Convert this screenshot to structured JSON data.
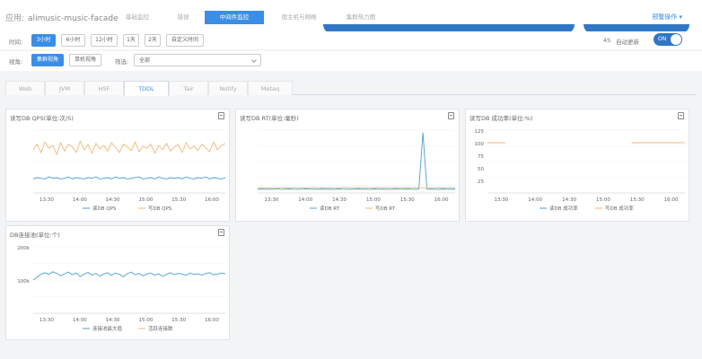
{
  "header": {
    "app_label": "应用:",
    "app_name": "alimusic-music-facade",
    "tabs": [
      {
        "label": "基础监控"
      },
      {
        "label": "错误"
      },
      {
        "label": "中间件监控"
      },
      {
        "label": "宿主机与网络"
      },
      {
        "label": "集群热力图"
      }
    ],
    "action_link": "预警操作 ▾"
  },
  "time_row": {
    "label": "时间:",
    "options": [
      "3小时",
      "6小时",
      "12小时",
      "1天",
      "2天",
      "自定义时间"
    ],
    "auto_label": "自动更新",
    "auto_interval": "4S",
    "toggle_text": "ON"
  },
  "view_row": {
    "label": "视角:",
    "views": [
      "集群视角",
      "单机视角"
    ],
    "filter_label": "筛选:",
    "filter_value": "全部"
  },
  "subtabs": [
    "Web",
    "JVM",
    "HSF",
    "TDDL",
    "Tair",
    "Notify",
    "Metaq"
  ],
  "colors": {
    "accent": "#3a8ee6",
    "series_blue": "#4d9fd6",
    "series_orange": "#f0b97a"
  },
  "panels": [
    {
      "title": "读写DB QPS(单位:次/S)",
      "legend": [
        "读DB QPS",
        "写DB QPS"
      ]
    },
    {
      "title": "读写DB RT(单位:毫秒)",
      "legend": [
        "读DB RT",
        "写DB RT"
      ]
    },
    {
      "title": "读写DB 成功率(单位:%)",
      "legend": [
        "读DB 成功率",
        "写DB 成功率"
      ]
    },
    {
      "title": "DB连接池(单位:个)",
      "legend": [
        "连接池最大值",
        "活跃连接数"
      ]
    }
  ],
  "chart_data": [
    {
      "type": "line",
      "title": "读写DB QPS(单位:次/S)",
      "x": [
        "13:30",
        "14:00",
        "14:30",
        "15:00",
        "15:30",
        "16:00"
      ],
      "series": [
        {
          "name": "写DB QPS",
          "color": "#f0b97a",
          "values": [
            62,
            70,
            58,
            73,
            64,
            68,
            55,
            72,
            60,
            70,
            66,
            58,
            74,
            62,
            69,
            57,
            71,
            63,
            68,
            60,
            72,
            65,
            58,
            70,
            66,
            61,
            73,
            59,
            67,
            64,
            70,
            57,
            68,
            62,
            71,
            60,
            66,
            69,
            58,
            72,
            63,
            67,
            61,
            70,
            65,
            59,
            73,
            62,
            68,
            71
          ]
        },
        {
          "name": "读DB QPS",
          "color": "#4d9fd6",
          "values": [
            20,
            22,
            21,
            20,
            23,
            21,
            22,
            20,
            21,
            23,
            20,
            22,
            21,
            20,
            22,
            21,
            23,
            20,
            21,
            22,
            20,
            23,
            21,
            22,
            20,
            21,
            22,
            23,
            20,
            21,
            22,
            20,
            23,
            21,
            20,
            22,
            21,
            22,
            20,
            23,
            21,
            20,
            22,
            21,
            23,
            20,
            22,
            21,
            20,
            22
          ]
        }
      ]
    },
    {
      "type": "line",
      "title": "读写DB RT(单位:毫秒)",
      "x": [
        "13:30",
        "14:00",
        "14:30",
        "15:00",
        "15:30",
        "16:00"
      ],
      "series": [
        {
          "name": "读DB RT",
          "color": "#4d9fd6",
          "values": [
            3,
            3.2,
            2.9,
            3.1,
            3,
            3.3,
            2.9,
            3.1,
            3.2,
            3,
            2.9,
            3.1,
            3.3,
            3,
            3.1,
            2.9,
            3.2,
            3,
            3.1,
            2.9,
            3.2,
            3.1,
            3,
            2.9,
            3.1,
            3.2,
            3,
            3.1,
            2.9,
            3.2,
            3,
            3.1,
            3,
            2.9,
            3.2,
            3.1,
            3,
            3.2,
            3,
            2.9,
            3.1,
            48,
            3,
            3.1,
            3,
            2.9,
            3.2,
            3,
            3.1,
            3
          ]
        },
        {
          "name": "写DB RT",
          "color": "#f0b97a",
          "values": [
            4,
            4.3,
            3.9,
            4.2,
            4.1,
            4,
            4.4,
            3.9,
            4.1,
            4.3,
            4,
            4.2,
            3.9,
            4.1,
            4.4,
            4,
            4.2,
            3.9,
            4.3,
            4.1,
            4,
            4.2,
            4.4,
            3.9,
            4.1,
            4.3,
            4,
            4.2,
            4.1,
            3.9,
            4.4,
            4,
            4.2,
            4.1,
            4.3,
            3.9,
            4.1,
            4.2,
            4,
            4.3,
            4.1,
            4,
            4.2,
            3.9,
            4.1,
            4.3,
            4,
            4.2,
            4.1,
            4
          ]
        }
      ]
    },
    {
      "type": "line",
      "title": "读写DB 成功率(单位:%)",
      "x": [
        "13:30",
        "14:00",
        "14:30",
        "15:00",
        "15:30",
        "16:00"
      ],
      "ylim": [
        0,
        125
      ],
      "yticks": [
        "125",
        "100",
        "75",
        "50",
        "25"
      ],
      "series": [
        {
          "name": "写DB 成功率",
          "color": "#f0b97a",
          "segments": [
            [
              [
                0,
                0.09
              ],
              100
            ],
            [
              [
                0.73,
                1
              ],
              100
            ]
          ]
        },
        {
          "name": "读DB 成功率",
          "color": "#4d9fd6",
          "segments": []
        }
      ]
    },
    {
      "type": "line",
      "title": "DB连接池(单位:个)",
      "x": [
        "13:30",
        "14:00",
        "14:30",
        "15:00",
        "15:30",
        "16:00"
      ],
      "yticks": [
        "200k",
        "100k"
      ],
      "series": [
        {
          "name": "连接池最大值",
          "color": "#4d9fd6",
          "values": [
            100,
            108,
            118,
            122,
            117,
            125,
            120,
            113,
            119,
            124,
            116,
            121,
            110,
            118,
            123,
            115,
            120,
            112,
            118,
            122,
            114,
            121,
            117,
            110,
            119,
            124,
            116,
            120,
            113,
            118,
            121,
            115,
            119,
            111,
            117,
            122,
            116,
            120,
            118,
            114,
            121,
            117,
            119,
            115,
            120,
            122,
            116,
            118,
            121,
            119
          ]
        },
        {
          "name": "活跃连接数",
          "color": "#f0b97a",
          "values": []
        }
      ]
    }
  ]
}
